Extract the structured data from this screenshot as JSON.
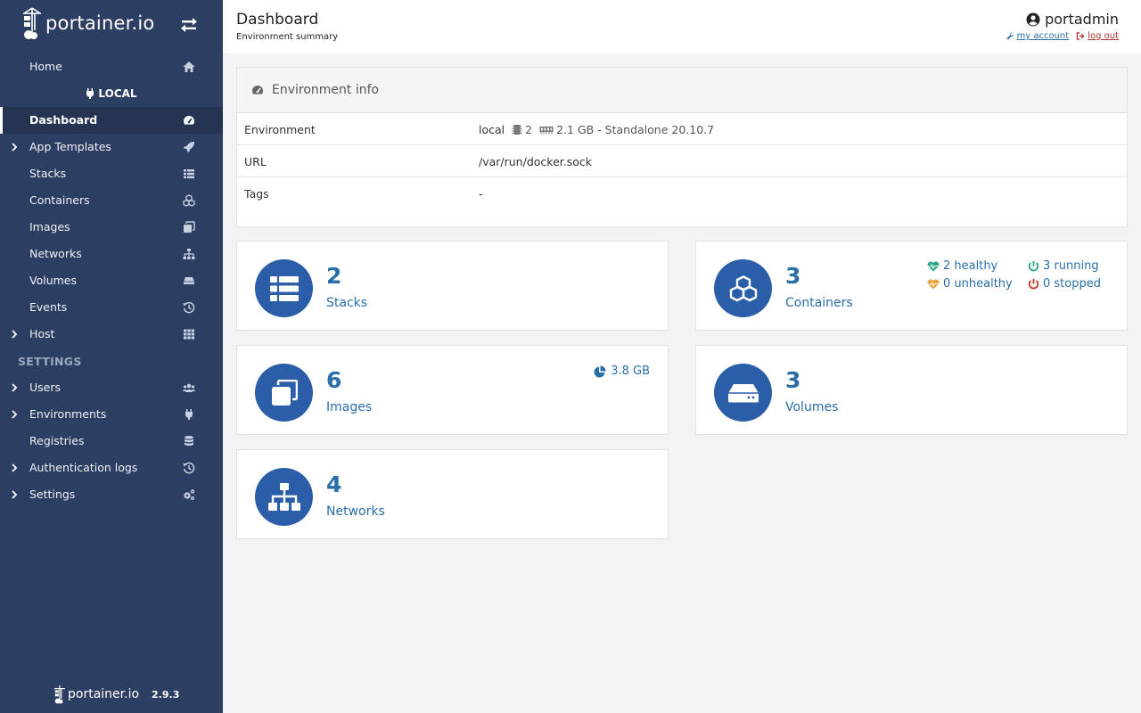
{
  "brand": {
    "name": "portainer.io",
    "version": "2.9.3"
  },
  "sidebar": {
    "home": "Home",
    "environment_name": "LOCAL",
    "items": [
      {
        "label": "Dashboard",
        "icon": "tachometer-icon",
        "active": true
      },
      {
        "label": "App Templates",
        "icon": "rocket-icon",
        "expandable": true
      },
      {
        "label": "Stacks",
        "icon": "th-list-icon"
      },
      {
        "label": "Containers",
        "icon": "cubes-icon"
      },
      {
        "label": "Images",
        "icon": "clone-icon"
      },
      {
        "label": "Networks",
        "icon": "sitemap-icon"
      },
      {
        "label": "Volumes",
        "icon": "hdd-icon"
      },
      {
        "label": "Events",
        "icon": "history-icon"
      },
      {
        "label": "Host",
        "icon": "th-icon",
        "expandable": true
      }
    ],
    "settings_title": "SETTINGS",
    "settings_items": [
      {
        "label": "Users",
        "icon": "users-icon",
        "expandable": true
      },
      {
        "label": "Environments",
        "icon": "plug-icon",
        "expandable": true
      },
      {
        "label": "Registries",
        "icon": "database-icon"
      },
      {
        "label": "Authentication logs",
        "icon": "history-icon",
        "expandable": true
      },
      {
        "label": "Settings",
        "icon": "cogs-icon",
        "expandable": true
      }
    ]
  },
  "header": {
    "title": "Dashboard",
    "subtitle": "Environment summary",
    "username": "portadmin",
    "my_account": "my account",
    "log_out": "log out"
  },
  "env_info": {
    "title": "Environment info",
    "rows": {
      "environment_label": "Environment",
      "environment_name": "local",
      "cpu": "2",
      "memory": "2.1 GB - Standalone 20.10.7",
      "url_label": "URL",
      "url": "/var/run/docker.sock",
      "tags_label": "Tags",
      "tags": "-"
    }
  },
  "widgets": {
    "stacks": {
      "count": "2",
      "label": "Stacks"
    },
    "containers": {
      "count": "3",
      "label": "Containers",
      "healthy": "2 healthy",
      "unhealthy": "0 unhealthy",
      "running": "3 running",
      "stopped": "0 stopped"
    },
    "images": {
      "count": "6",
      "label": "Images",
      "size": "3.8 GB"
    },
    "volumes": {
      "count": "3",
      "label": "Volumes"
    },
    "networks": {
      "count": "4",
      "label": "Networks"
    }
  },
  "colors": {
    "sidebar": "#2d3e63",
    "accent": "#2a6ea8",
    "circle": "#2a5ea8",
    "healthy": "#2ea68a",
    "unhealthy": "#e8a43a",
    "running": "#2ea68a",
    "stopped": "#c0392b"
  }
}
